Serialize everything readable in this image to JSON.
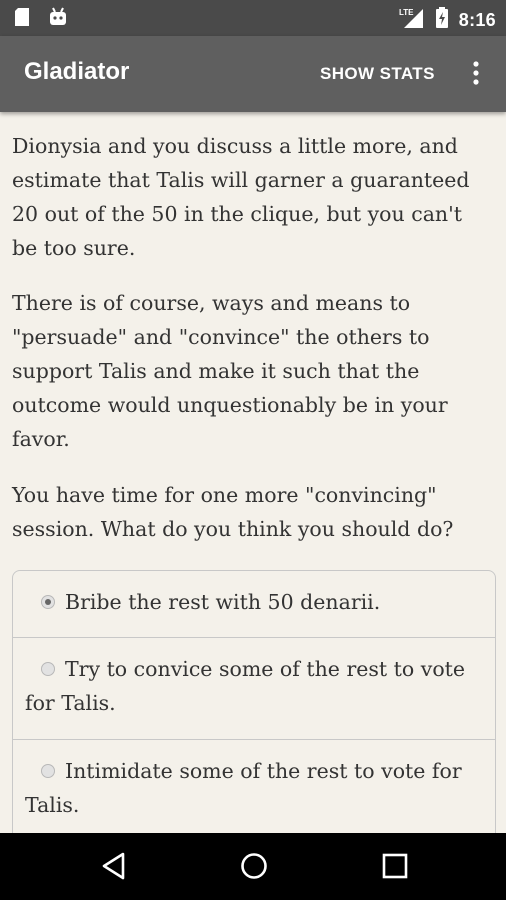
{
  "status_bar": {
    "time": "8:16",
    "network": "LTE",
    "left_icons": [
      "sd-card-icon",
      "android-icon"
    ],
    "right_icons": [
      "signal-icon",
      "battery-icon"
    ]
  },
  "app_bar": {
    "title": "Gladiator",
    "show_stats_label": "SHOW STATS",
    "overflow_icon": "more-vert-icon"
  },
  "content": {
    "paragraphs": [
      "Dionysia and you discuss a little more, and estimate that Talis will garner a guaranteed 20 out of the 50 in the clique, but you can't be too sure.",
      "There is of course, ways and means to \"persuade\" and \"convince\" the others to support Talis and make it such that the outcome would unquestionably be in your favor.",
      "You have time for one more \"convincing\" session. What do you think you should do?"
    ],
    "choices": [
      {
        "label": "Bribe the rest with 50 denarii.",
        "selected": true
      },
      {
        "label": "Try to convice some of the rest to vote for Talis.",
        "selected": false
      },
      {
        "label": "Intimidate some of the rest to vote for Talis.",
        "selected": false
      }
    ]
  },
  "nav_bar": {
    "icons": [
      "back-icon",
      "home-icon",
      "recents-icon"
    ]
  },
  "colors": {
    "status_bar_bg": "#4a4a4a",
    "app_bar_bg": "#5f5f5f",
    "page_bg": "#f4f1ea",
    "text": "#333333",
    "nav_bar_bg": "#000000"
  }
}
